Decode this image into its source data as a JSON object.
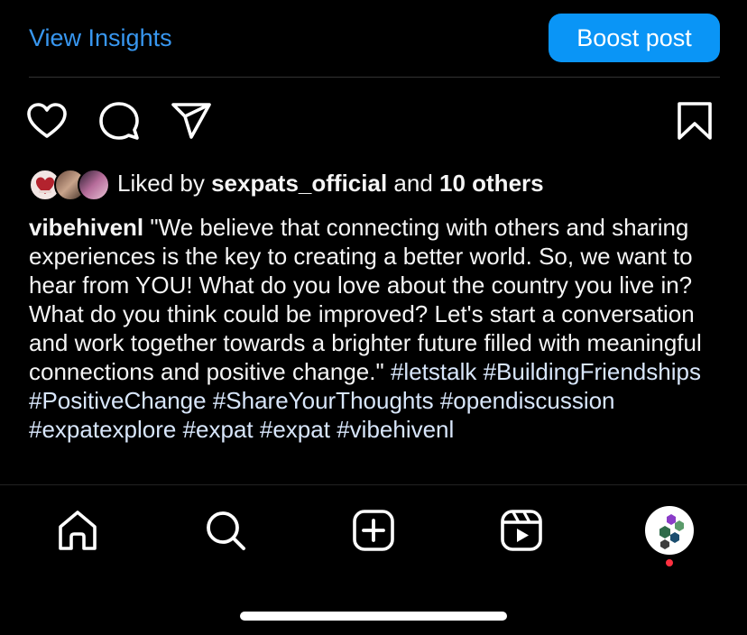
{
  "header": {
    "view_insights": "View Insights",
    "boost_post": "Boost post"
  },
  "actions": {
    "like_icon": "heart-icon",
    "comment_icon": "comment-icon",
    "share_icon": "send-icon",
    "save_icon": "bookmark-icon"
  },
  "likes": {
    "prefix": "Liked by ",
    "user": "sexpats_official",
    "middle": " and ",
    "others": "10 others"
  },
  "caption": {
    "username": "vibehivenl",
    "text": "\"We believe that connecting with others and sharing experiences is the key to creating a better world. So, we want to hear from YOU! What do you love about the country you live in? What do you think could be improved? Let's start a conversation and work together towards a brighter future filled with meaningful connections and positive change.\"",
    "hashtags": [
      "#letstalk",
      "#BuildingFriendships",
      "#PositiveChange",
      "#ShareYourThoughts",
      "#opendiscussion",
      "#expatexplore",
      "#expat",
      "#expat",
      "#vibehivenl"
    ]
  },
  "bottom_nav": {
    "items": [
      "home-icon",
      "search-icon",
      "create-icon",
      "reels-icon",
      "profile-avatar"
    ]
  },
  "colors": {
    "accent": "#0a95f6",
    "link": "#3897f0",
    "notification": "#ff3040"
  }
}
